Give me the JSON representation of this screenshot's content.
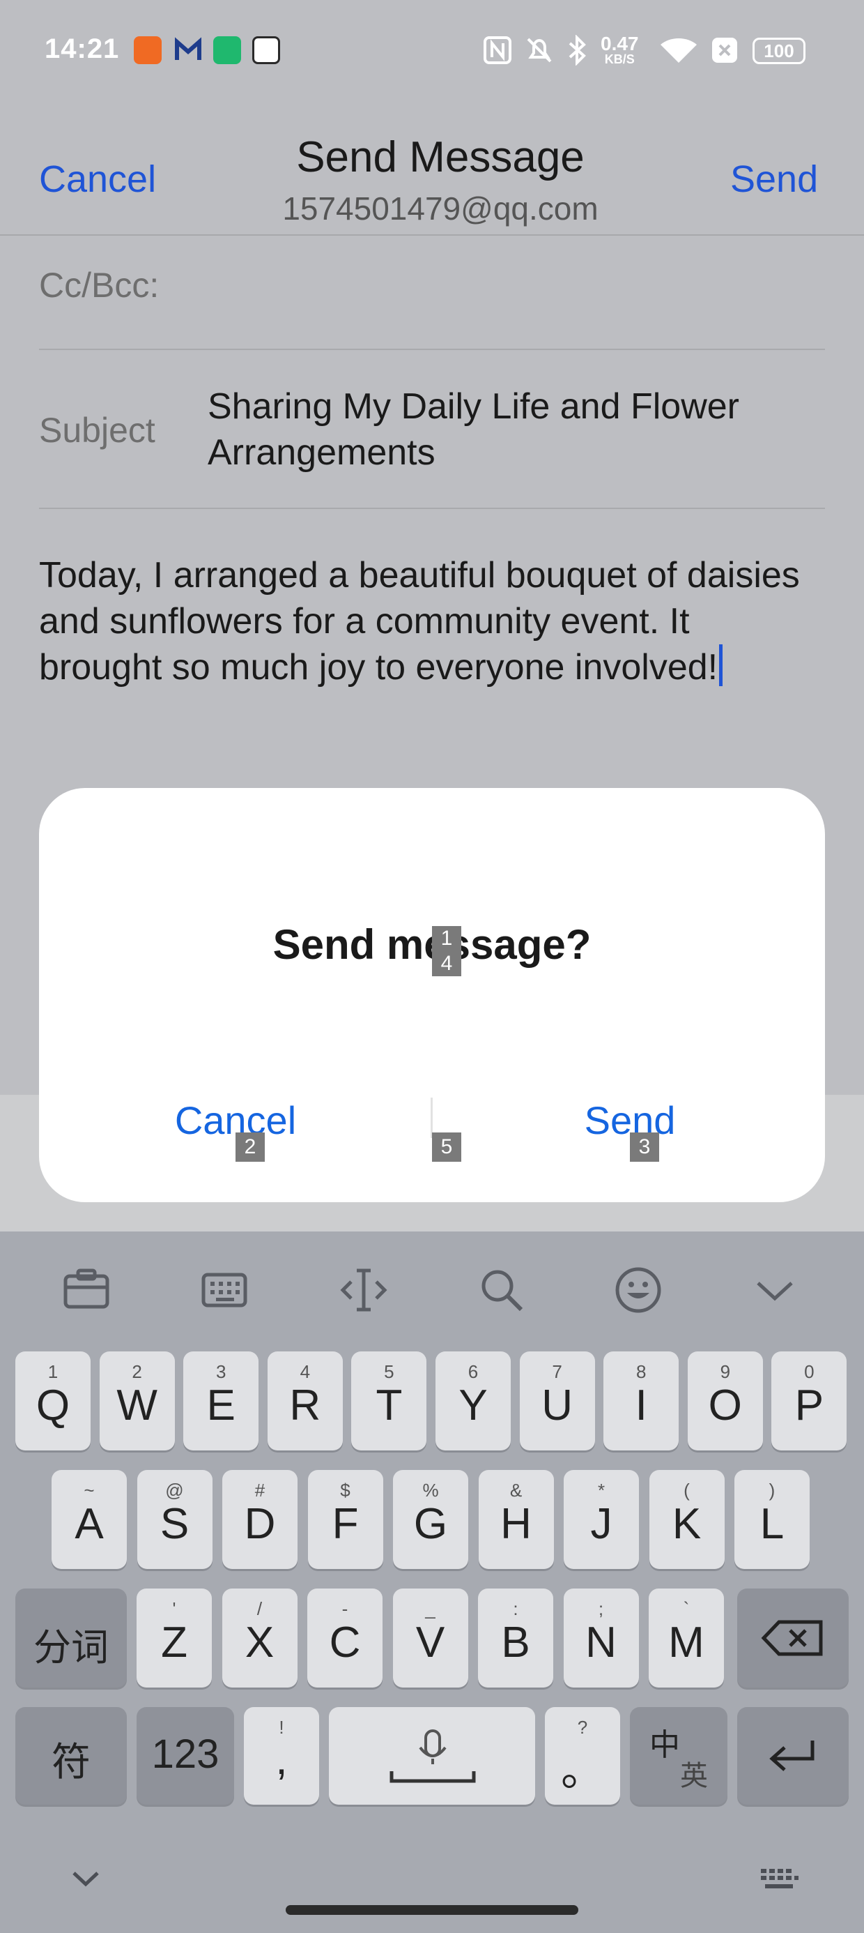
{
  "status_bar": {
    "time": "14:21",
    "net_speed_value": "0.47",
    "net_speed_unit": "KB/S",
    "battery": "100"
  },
  "header": {
    "cancel": "Cancel",
    "title": "Send Message",
    "from": "1574501479@qq.com",
    "send": "Send"
  },
  "compose": {
    "cc_label": "Cc/Bcc:",
    "subject_label": "Subject",
    "subject_value": "Sharing My Daily Life and Flower Arrangements",
    "body": "Today, I arranged a beautiful bouquet of daisies and sunflowers for a community event. It brought so much joy to everyone involved!"
  },
  "dialog": {
    "title": "Send message?",
    "cancel": "Cancel",
    "send": "Send",
    "tags": [
      "1",
      "2",
      "3",
      "4",
      "5"
    ]
  },
  "keyboard": {
    "toolbar_icons": [
      "clipboard-icon",
      "keyboard-layout-icon",
      "cursor-icon",
      "search-icon",
      "emoji-icon",
      "collapse-icon"
    ],
    "row1": [
      {
        "main": "Q",
        "hint": "1"
      },
      {
        "main": "W",
        "hint": "2"
      },
      {
        "main": "E",
        "hint": "3"
      },
      {
        "main": "R",
        "hint": "4"
      },
      {
        "main": "T",
        "hint": "5"
      },
      {
        "main": "Y",
        "hint": "6"
      },
      {
        "main": "U",
        "hint": "7"
      },
      {
        "main": "I",
        "hint": "8"
      },
      {
        "main": "O",
        "hint": "9"
      },
      {
        "main": "P",
        "hint": "0"
      }
    ],
    "row2": [
      {
        "main": "A",
        "hint": "~"
      },
      {
        "main": "S",
        "hint": "@"
      },
      {
        "main": "D",
        "hint": "#"
      },
      {
        "main": "F",
        "hint": "$"
      },
      {
        "main": "G",
        "hint": "%"
      },
      {
        "main": "H",
        "hint": "&"
      },
      {
        "main": "J",
        "hint": "*"
      },
      {
        "main": "K",
        "hint": "("
      },
      {
        "main": "L",
        "hint": ")"
      }
    ],
    "row3_left": "分词",
    "row3": [
      {
        "main": "Z",
        "hint": "'"
      },
      {
        "main": "X",
        "hint": "/"
      },
      {
        "main": "C",
        "hint": "-"
      },
      {
        "main": "V",
        "hint": "_"
      },
      {
        "main": "B",
        "hint": ":"
      },
      {
        "main": "N",
        "hint": ";"
      },
      {
        "main": "M",
        "hint": "`"
      }
    ],
    "row4": {
      "symbols": "符",
      "numbers": "123",
      "comma": ",",
      "comma_hint": "!",
      "period": "。",
      "period_hint": "?",
      "lang_main": "中",
      "lang_sub": "英"
    }
  }
}
